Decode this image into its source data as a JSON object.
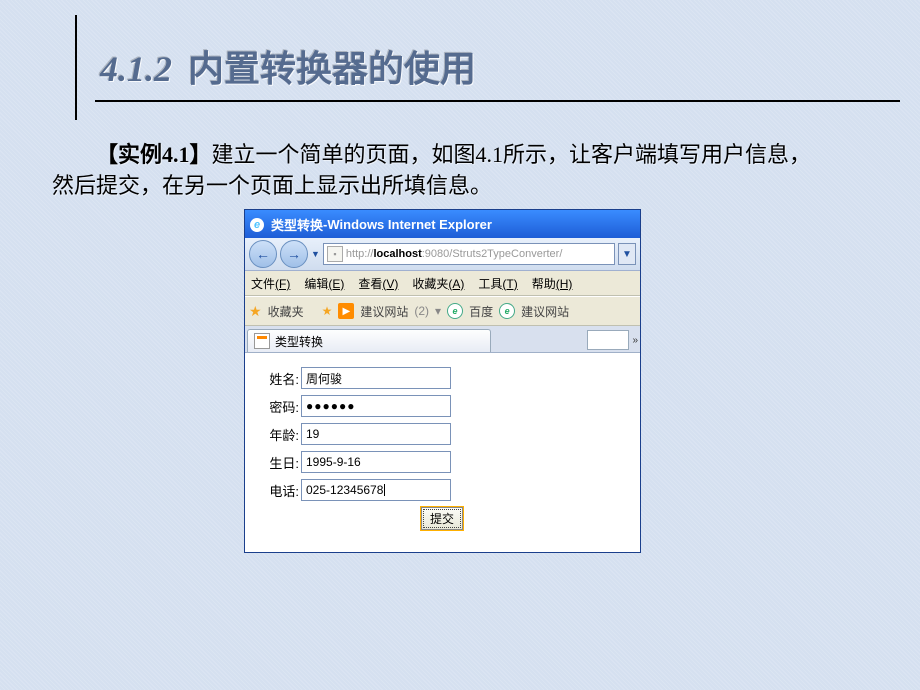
{
  "heading": {
    "number": "4.1.2",
    "text": "内置转换器的使用"
  },
  "body": {
    "example_label": "【实例4.1】",
    "paragraph_1": "建立一个简单的页面，如图4.1所示，让客户端填写用户信息，",
    "paragraph_2": "然后提交，在另一个页面上显示出所填信息。"
  },
  "browser": {
    "title_prefix": "类型转换",
    "title_sep": " - ",
    "title_app": "Windows Internet Explorer",
    "url_prefix": "http://",
    "url_host": "localhost",
    "url_suffix": ":9080/Struts2TypeConverter/",
    "menu": {
      "file": "文件",
      "file_k": "(F)",
      "edit": "编辑",
      "edit_k": "(E)",
      "view": "查看",
      "view_k": "(V)",
      "fav": "收藏夹",
      "fav_k": "(A)",
      "tools": "工具",
      "tools_k": "(T)",
      "help": "帮助",
      "help_k": "(H)"
    },
    "favbar": {
      "label": "收藏夹",
      "suggest": "建议网站",
      "count": "(2)",
      "arrow": "▾",
      "baidu": "百度",
      "suggest2": "建议网站"
    },
    "tab_title": "类型转换",
    "form": {
      "name_label": "姓名:",
      "name_value": "周何骏",
      "password_label": "密码:",
      "password_value": "●●●●●●",
      "age_label": "年龄:",
      "age_value": "19",
      "birthday_label": "生日:",
      "birthday_value": "1995-9-16",
      "phone_label": "电话:",
      "phone_value": "025-12345678",
      "submit_label": "提交"
    }
  }
}
